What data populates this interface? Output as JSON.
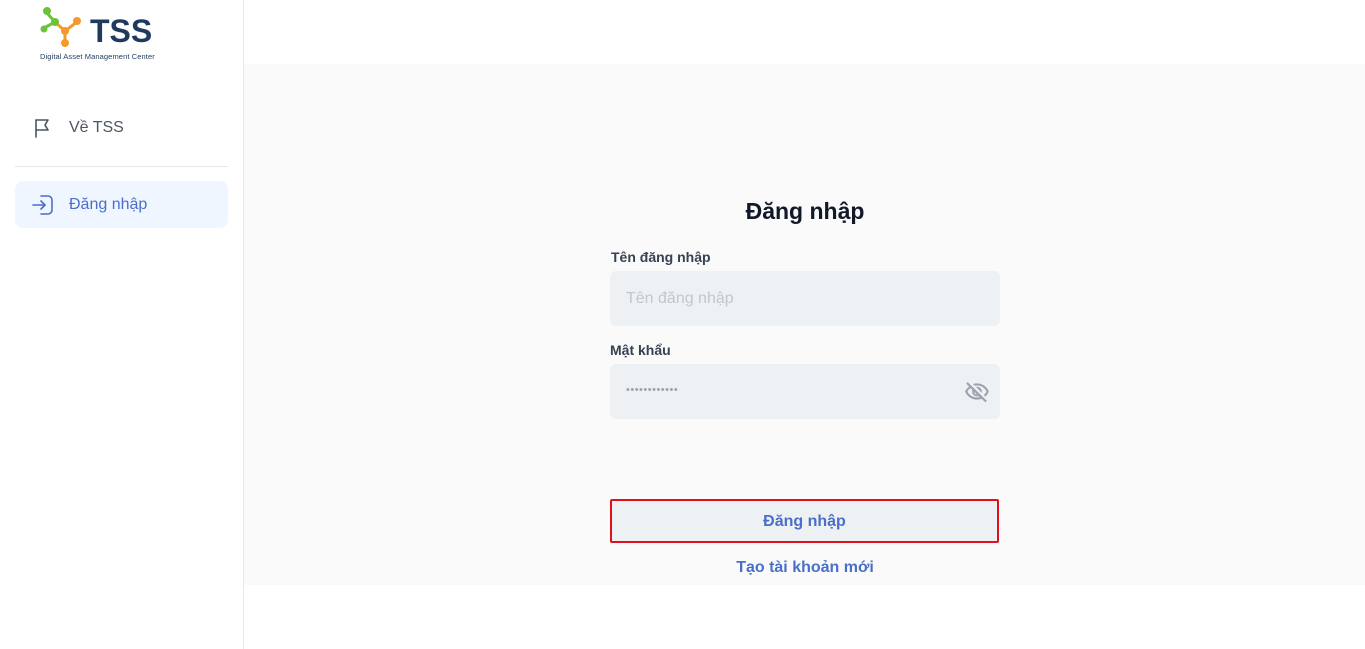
{
  "brand": {
    "name": "TSS",
    "tagline": "Digital Asset Management Center",
    "colors": {
      "green": "#6cc23a",
      "orange": "#f39a2c",
      "navy": "#1f3a5f"
    }
  },
  "sidebar": {
    "items": [
      {
        "label": "Về TSS",
        "icon": "flag-icon",
        "active": false
      },
      {
        "label": "Đăng nhập",
        "icon": "login-icon",
        "active": true
      }
    ]
  },
  "login": {
    "title": "Đăng nhập",
    "username": {
      "label": "Tên đăng nhập",
      "placeholder": "Tên đăng nhập",
      "value": ""
    },
    "password": {
      "label": "Mật khẩu",
      "masked_value": "••••••••••••",
      "toggle_icon": "eye-off-icon"
    },
    "submit_label": "Đăng nhập",
    "create_account_label": "Tạo tài khoản mới"
  },
  "colors": {
    "accent": "#4a6fc8",
    "highlight_border": "#e0101a",
    "input_bg": "#eef1f4"
  }
}
